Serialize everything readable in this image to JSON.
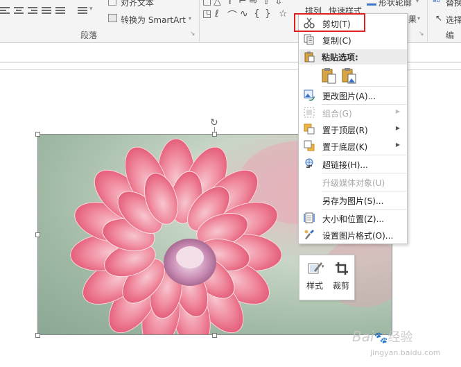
{
  "ribbon": {
    "paragraph": {
      "align_text_label": "对齐文本",
      "convert_smartart_label": "转换为 SmartArt",
      "group_label": "段落"
    },
    "arrange_label": "排列",
    "quick_styles_label": "快速样式",
    "shape_outline_label": "形状轮廓",
    "replace_label": "替换",
    "select_label": "选择",
    "edit_group_label": "编辑"
  },
  "context_menu": {
    "items": [
      {
        "label": "剪切(T)",
        "icon": "scissors-icon",
        "enabled": true
      },
      {
        "label": "复制(C)",
        "icon": "copy-icon",
        "enabled": true
      },
      {
        "label": "粘贴选项:",
        "icon": "paste-icon",
        "enabled": true,
        "header": true
      },
      {
        "label": "更改图片(A)...",
        "icon": "change-picture-icon",
        "enabled": true
      },
      {
        "label": "组合(G)",
        "icon": "group-icon",
        "enabled": false,
        "submenu": true
      },
      {
        "label": "置于顶层(R)",
        "icon": "bring-to-front-icon",
        "enabled": true,
        "submenu": true
      },
      {
        "label": "置于底层(K)",
        "icon": "send-to-back-icon",
        "enabled": true,
        "submenu": true
      },
      {
        "label": "超链接(H)...",
        "icon": "hyperlink-icon",
        "enabled": true
      },
      {
        "label": "升级媒体对象(U)",
        "icon": "",
        "enabled": false
      },
      {
        "label": "另存为图片(S)...",
        "icon": "",
        "enabled": true
      },
      {
        "label": "大小和位置(Z)...",
        "icon": "size-position-icon",
        "enabled": true
      },
      {
        "label": "设置图片格式(O)...",
        "icon": "format-picture-icon",
        "enabled": true
      }
    ]
  },
  "mini_toolbar": {
    "style_label": "样式",
    "crop_label": "裁剪"
  },
  "watermark": {
    "brand": "Bai",
    "brand_suffix": "经验",
    "url": "jingyan.baidu.com"
  },
  "colors": {
    "highlight": "#e02020",
    "menu_hover": "#ececec",
    "disabled_text": "#a8a8a8"
  }
}
